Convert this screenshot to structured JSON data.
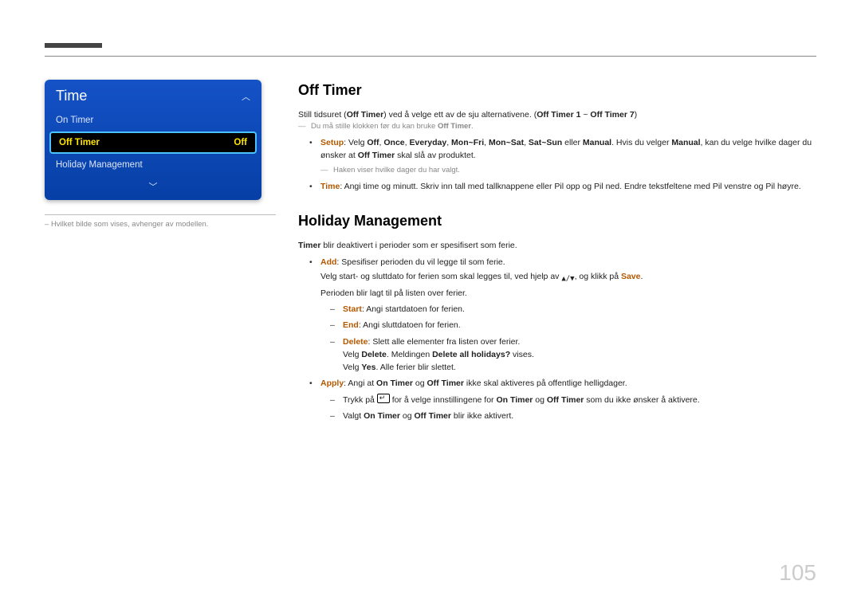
{
  "page_number": "105",
  "menu": {
    "title": "Time",
    "items": [
      {
        "label": "On Timer",
        "selected": false
      },
      {
        "label": "Off Timer",
        "value": "Off",
        "selected": true
      },
      {
        "label": "Holiday Management",
        "selected": false
      }
    ]
  },
  "caption": "Hvilket bilde som vises, avhenger av modellen.",
  "section1": {
    "heading": "Off Timer",
    "intro_a": "Still tidsuret (",
    "intro_term": "Off Timer",
    "intro_b": ") ved å velge ett av de sju alternativene. (",
    "intro_range_a": "Off Timer 1",
    "intro_tilde": " ~ ",
    "intro_range_b": "Off Timer 7",
    "intro_c": ")",
    "note1_a": "Du må stille klokken før du kan bruke ",
    "note1_b": "Off Timer",
    "note1_c": ".",
    "setup": {
      "label": "Setup",
      "a": ": Velg ",
      "opts": [
        "Off",
        "Once",
        "Everyday",
        "Mon~Fri",
        "Mon~Sat",
        "Sat~Sun"
      ],
      "sep": ", ",
      "or": " eller ",
      "manual": "Manual",
      "b": ". Hvis du velger ",
      "c": ", kan du velge hvilke dager du ønsker at ",
      "off_timer": "Off Timer",
      "d": " skal slå av produktet."
    },
    "note2": "Haken viser hvilke dager du har valgt.",
    "time": {
      "label": "Time",
      "text": ": Angi time og minutt. Skriv inn tall med tallknappene eller Pil opp og Pil ned. Endre tekstfeltene med Pil venstre og Pil høyre."
    }
  },
  "section2": {
    "heading": "Holiday Management",
    "intro_term": "Timer",
    "intro_rest": " blir deaktivert i perioder som er spesifisert som ferie.",
    "add": {
      "label": "Add",
      "a": ": Spesifiser perioden du vil legge til som ferie.",
      "b_a": "Velg start- og sluttdato for ferien som skal legges til, ved hjelp av ",
      "b_b": ", og klikk på ",
      "save": "Save",
      "b_c": ".",
      "c": "Perioden blir lagt til på listen over ferier.",
      "start_label": "Start",
      "start_text": ": Angi startdatoen for ferien.",
      "end_label": "End",
      "end_text": ": Angi sluttdatoen for ferien.",
      "delete_label": "Delete",
      "delete_text": ": Slett alle elementer fra listen over ferier.",
      "del2_a": "Velg ",
      "del2_b": "Delete",
      "del2_c": ". Meldingen ",
      "del2_d": "Delete all holidays?",
      "del2_e": " vises.",
      "del3_a": "Velg ",
      "del3_b": "Yes",
      "del3_c": ". Alle ferier blir slettet."
    },
    "apply": {
      "label": "Apply",
      "a": ": Angi at ",
      "on_timer": "On Timer",
      "and": " og ",
      "off_timer": "Off Timer",
      "b": " ikke skal aktiveres på offentlige helligdager.",
      "d1_a": "Trykk på ",
      "d1_b": " for å velge innstillingene for ",
      "d1_c": " som du ikke ønsker å aktivere.",
      "d2_a": "Valgt ",
      "d2_b": " blir ikke aktivert."
    }
  }
}
